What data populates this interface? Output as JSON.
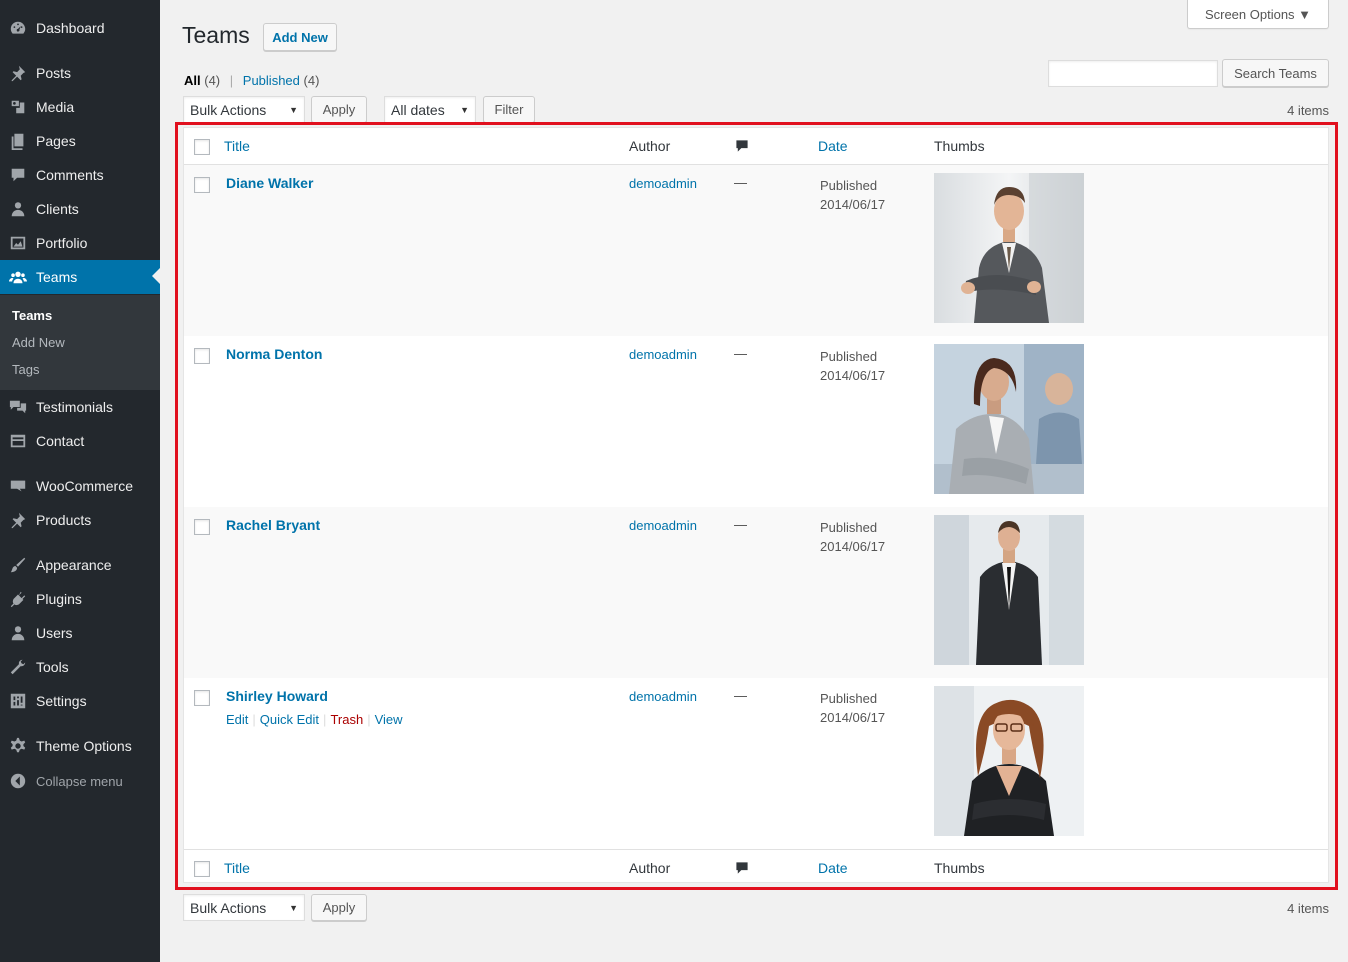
{
  "sidebar": {
    "items": [
      {
        "label": "Dashboard",
        "icon": "dashboard-icon"
      },
      {
        "label": "Posts",
        "icon": "pin-icon"
      },
      {
        "label": "Media",
        "icon": "media-icon"
      },
      {
        "label": "Pages",
        "icon": "pages-icon"
      },
      {
        "label": "Comments",
        "icon": "comment-icon"
      },
      {
        "label": "Clients",
        "icon": "user-icon"
      },
      {
        "label": "Portfolio",
        "icon": "portfolio-icon"
      },
      {
        "label": "Teams",
        "icon": "groups-icon"
      },
      {
        "label": "Testimonials",
        "icon": "testimonial-icon"
      },
      {
        "label": "Contact",
        "icon": "contact-icon"
      },
      {
        "label": "WooCommerce",
        "icon": "woo-icon"
      },
      {
        "label": "Products",
        "icon": "pin-icon"
      },
      {
        "label": "Appearance",
        "icon": "brush-icon"
      },
      {
        "label": "Plugins",
        "icon": "plugin-icon"
      },
      {
        "label": "Users",
        "icon": "user-icon"
      },
      {
        "label": "Tools",
        "icon": "wrench-icon"
      },
      {
        "label": "Settings",
        "icon": "settings-icon"
      },
      {
        "label": "Theme Options",
        "icon": "gear-icon"
      }
    ],
    "submenu": [
      "Teams",
      "Add New",
      "Tags"
    ],
    "collapse_label": "Collapse menu"
  },
  "header": {
    "title": "Teams",
    "add_new": "Add New",
    "screen_options": "Screen Options ▼",
    "search_button": "Search Teams",
    "search_value": ""
  },
  "views": {
    "all": "All",
    "all_count": "(4)",
    "published": "Published",
    "published_count": "(4)"
  },
  "tablenav": {
    "bulk_actions": "Bulk Actions",
    "apply": "Apply",
    "all_dates": "All dates",
    "filter": "Filter",
    "items_count": "4 items"
  },
  "columns": {
    "title": "Title",
    "author": "Author",
    "date": "Date",
    "thumbs": "Thumbs"
  },
  "rows": [
    {
      "title": "Diane Walker",
      "author": "demoadmin",
      "comments": "—",
      "status": "Published",
      "date": "2014/06/17"
    },
    {
      "title": "Norma Denton",
      "author": "demoadmin",
      "comments": "—",
      "status": "Published",
      "date": "2014/06/17"
    },
    {
      "title": "Rachel Bryant",
      "author": "demoadmin",
      "comments": "—",
      "status": "Published",
      "date": "2014/06/17"
    },
    {
      "title": "Shirley Howard",
      "author": "demoadmin",
      "comments": "—",
      "status": "Published",
      "date": "2014/06/17"
    }
  ],
  "row_actions": {
    "edit": "Edit",
    "quick_edit": "Quick Edit",
    "trash": "Trash",
    "view": "View"
  },
  "colors": {
    "sidebar_bg": "#23282d",
    "accent": "#0073aa",
    "highlight_border": "#e1101e"
  }
}
